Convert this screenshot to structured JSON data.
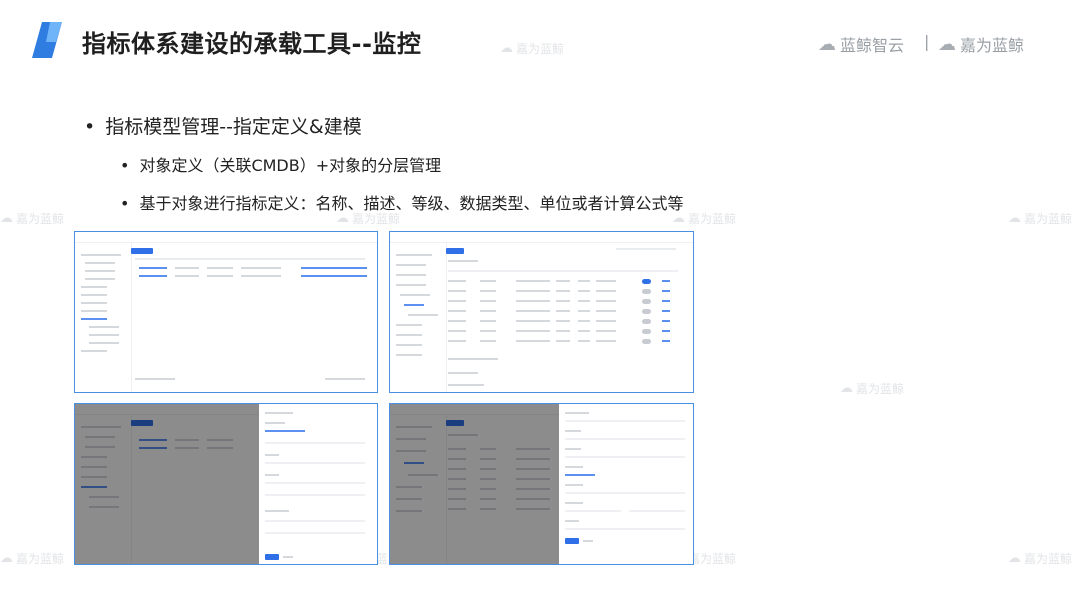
{
  "header": {
    "title": "指标体系建设的承载工具--监控",
    "brand_left": "蓝鲸智云",
    "brand_sep": "|",
    "brand_right": "嘉为蓝鲸"
  },
  "watermark": {
    "text": "嘉为蓝鲸"
  },
  "content": {
    "bullet_main": "指标模型管理--指定定义&建模",
    "bullet_sub1": "对象定义（关联CMDB）+对象的分层管理",
    "bullet_sub2": "基于对象进行指标定义：名称、描述、等级、数据类型、单位或者计算公式等",
    "bullet_glyph": "•"
  },
  "colors": {
    "accent": "#2f6fe8",
    "frame": "#4a90e2",
    "title": "#1f1f1f",
    "watermark": "#e2e4e7"
  },
  "icons": {
    "logo": "blue-parallelogram-logo",
    "brand": "cloud-icon"
  }
}
